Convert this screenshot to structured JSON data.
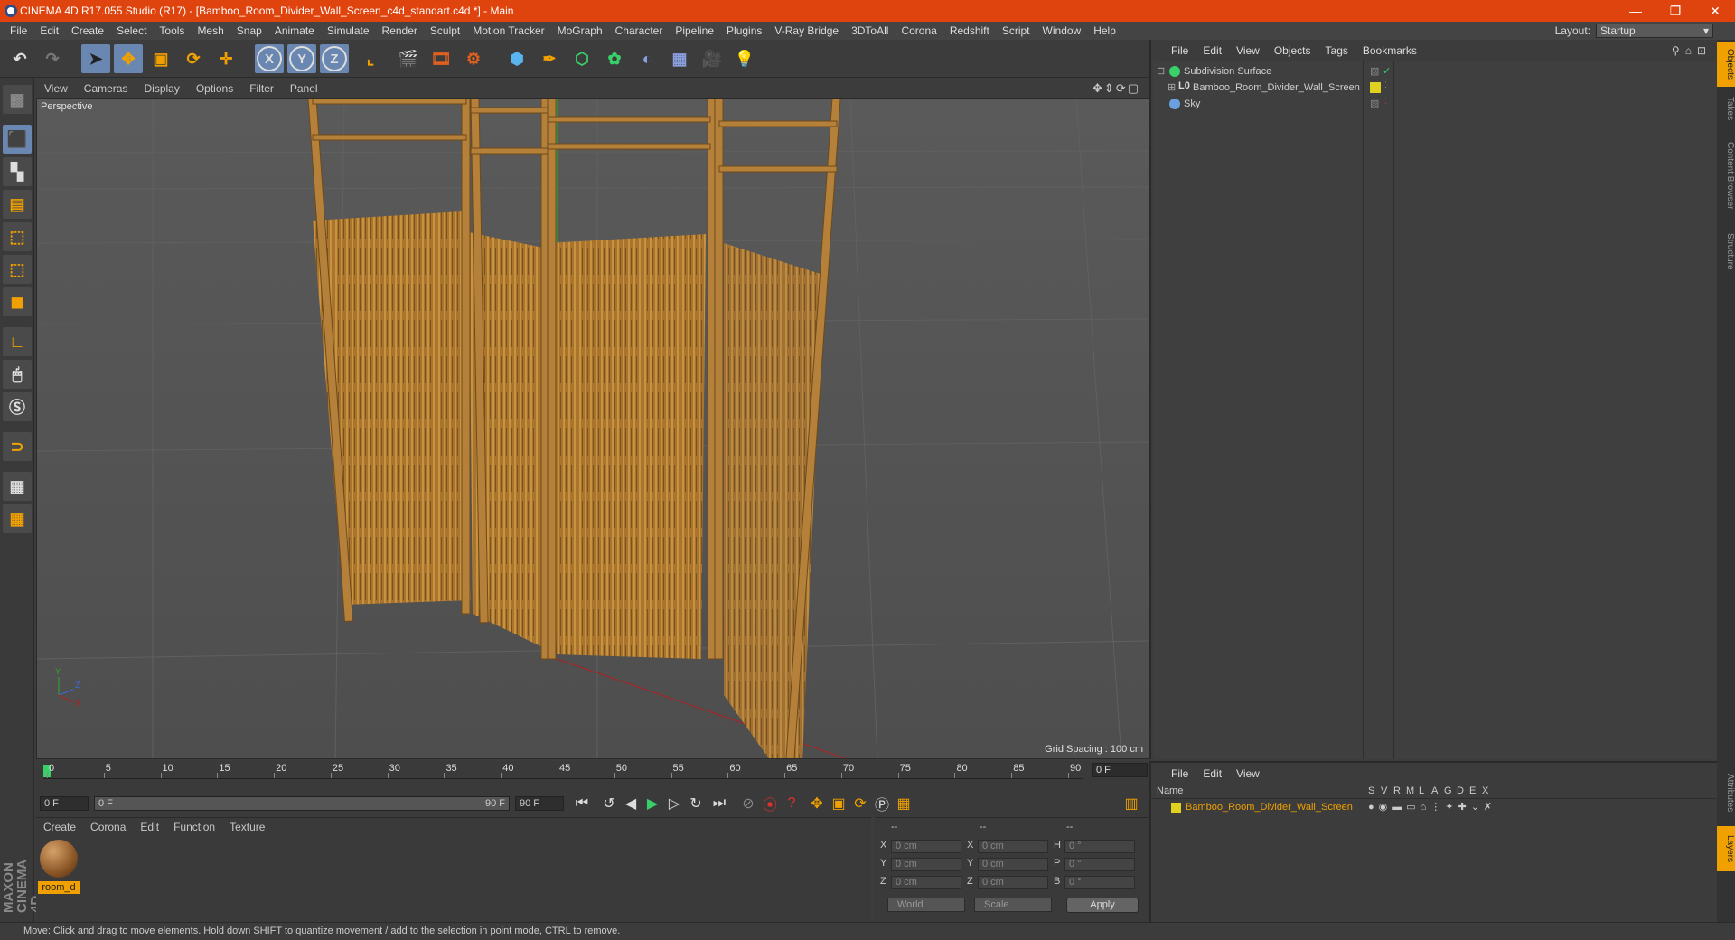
{
  "window": {
    "title": "CINEMA 4D R17.055 Studio (R17) - [Bamboo_Room_Divider_Wall_Screen_c4d_standart.c4d *] - Main",
    "minimize": "—",
    "restore": "❐",
    "close": "✕"
  },
  "menubar": {
    "items": [
      "File",
      "Edit",
      "Create",
      "Select",
      "Tools",
      "Mesh",
      "Snap",
      "Animate",
      "Simulate",
      "Render",
      "Sculpt",
      "Motion Tracker",
      "MoGraph",
      "Character",
      "Pipeline",
      "Plugins",
      "V-Ray Bridge",
      "3DToAll",
      "Corona",
      "Redshift",
      "Script",
      "Window",
      "Help"
    ],
    "layout_label": "Layout:",
    "layout_value": "Startup"
  },
  "toolbar": {
    "x_label": "X",
    "y_label": "Y",
    "z_label": "Z"
  },
  "viewport": {
    "menu": [
      "View",
      "Cameras",
      "Display",
      "Options",
      "Filter",
      "Panel"
    ],
    "nav_icons": "✥⇕⟳▢",
    "label": "Perspective",
    "grid_spacing": "Grid Spacing : 100 cm",
    "axis_labels": {
      "y": "Y",
      "z": "Z",
      "x": "X"
    }
  },
  "timeline": {
    "ticks": [
      "0",
      "5",
      "10",
      "15",
      "20",
      "25",
      "30",
      "35",
      "40",
      "45",
      "50",
      "55",
      "60",
      "65",
      "70",
      "75",
      "80",
      "85",
      "90"
    ],
    "current_frame": "0 F",
    "start_field": "0 F",
    "slider_left": "0 F",
    "slider_right": "90 F",
    "end_field": "90 F"
  },
  "material_manager": {
    "menu": [
      "Create",
      "Corona",
      "Edit",
      "Function",
      "Texture"
    ],
    "material_name": "room_d"
  },
  "coordinates": {
    "headers": [
      "--",
      "--",
      "--"
    ],
    "rows": [
      {
        "l1": "X",
        "v1": "0 cm",
        "l2": "X",
        "v2": "0 cm",
        "l3": "H",
        "v3": "0 °"
      },
      {
        "l1": "Y",
        "v1": "0 cm",
        "l2": "Y",
        "v2": "0 cm",
        "l3": "P",
        "v3": "0 °"
      },
      {
        "l1": "Z",
        "v1": "0 cm",
        "l2": "Z",
        "v2": "0 cm",
        "l3": "B",
        "v3": "0 °"
      }
    ],
    "space": "World",
    "mode": "Scale",
    "apply_label": "Apply"
  },
  "object_manager": {
    "menu": [
      "File",
      "Edit",
      "View",
      "Objects",
      "Tags",
      "Bookmarks"
    ],
    "objects": [
      {
        "name": "Subdivision Surface",
        "indent": 0,
        "color": "#39d06a"
      },
      {
        "name": "Bamboo_Room_Divider_Wall_Screen",
        "indent": 1,
        "color": "#c8c8c8"
      },
      {
        "name": "Sky",
        "indent": 0,
        "color": "#6aa0e0"
      }
    ]
  },
  "layer_manager": {
    "menu": [
      "File",
      "Edit",
      "View"
    ],
    "headers": {
      "name": "Name",
      "cols": [
        "S",
        "V",
        "R",
        "M",
        "L",
        "A",
        "G",
        "D",
        "E",
        "X"
      ]
    },
    "layer_name": "Bamboo_Room_Divider_Wall_Screen"
  },
  "right_tabs": [
    "Objects",
    "Takes",
    "Content Browser",
    "Structure",
    "Attributes",
    "Layers"
  ],
  "status": "Move: Click and drag to move elements. Hold down SHIFT to quantize movement / add to the selection in point mode, CTRL to remove.",
  "maxon_logo": "MAXON CINEMA 4D",
  "colors": {
    "accent": "#e0440e",
    "selection": "#6a87b2",
    "highlight": "#f0a000"
  }
}
